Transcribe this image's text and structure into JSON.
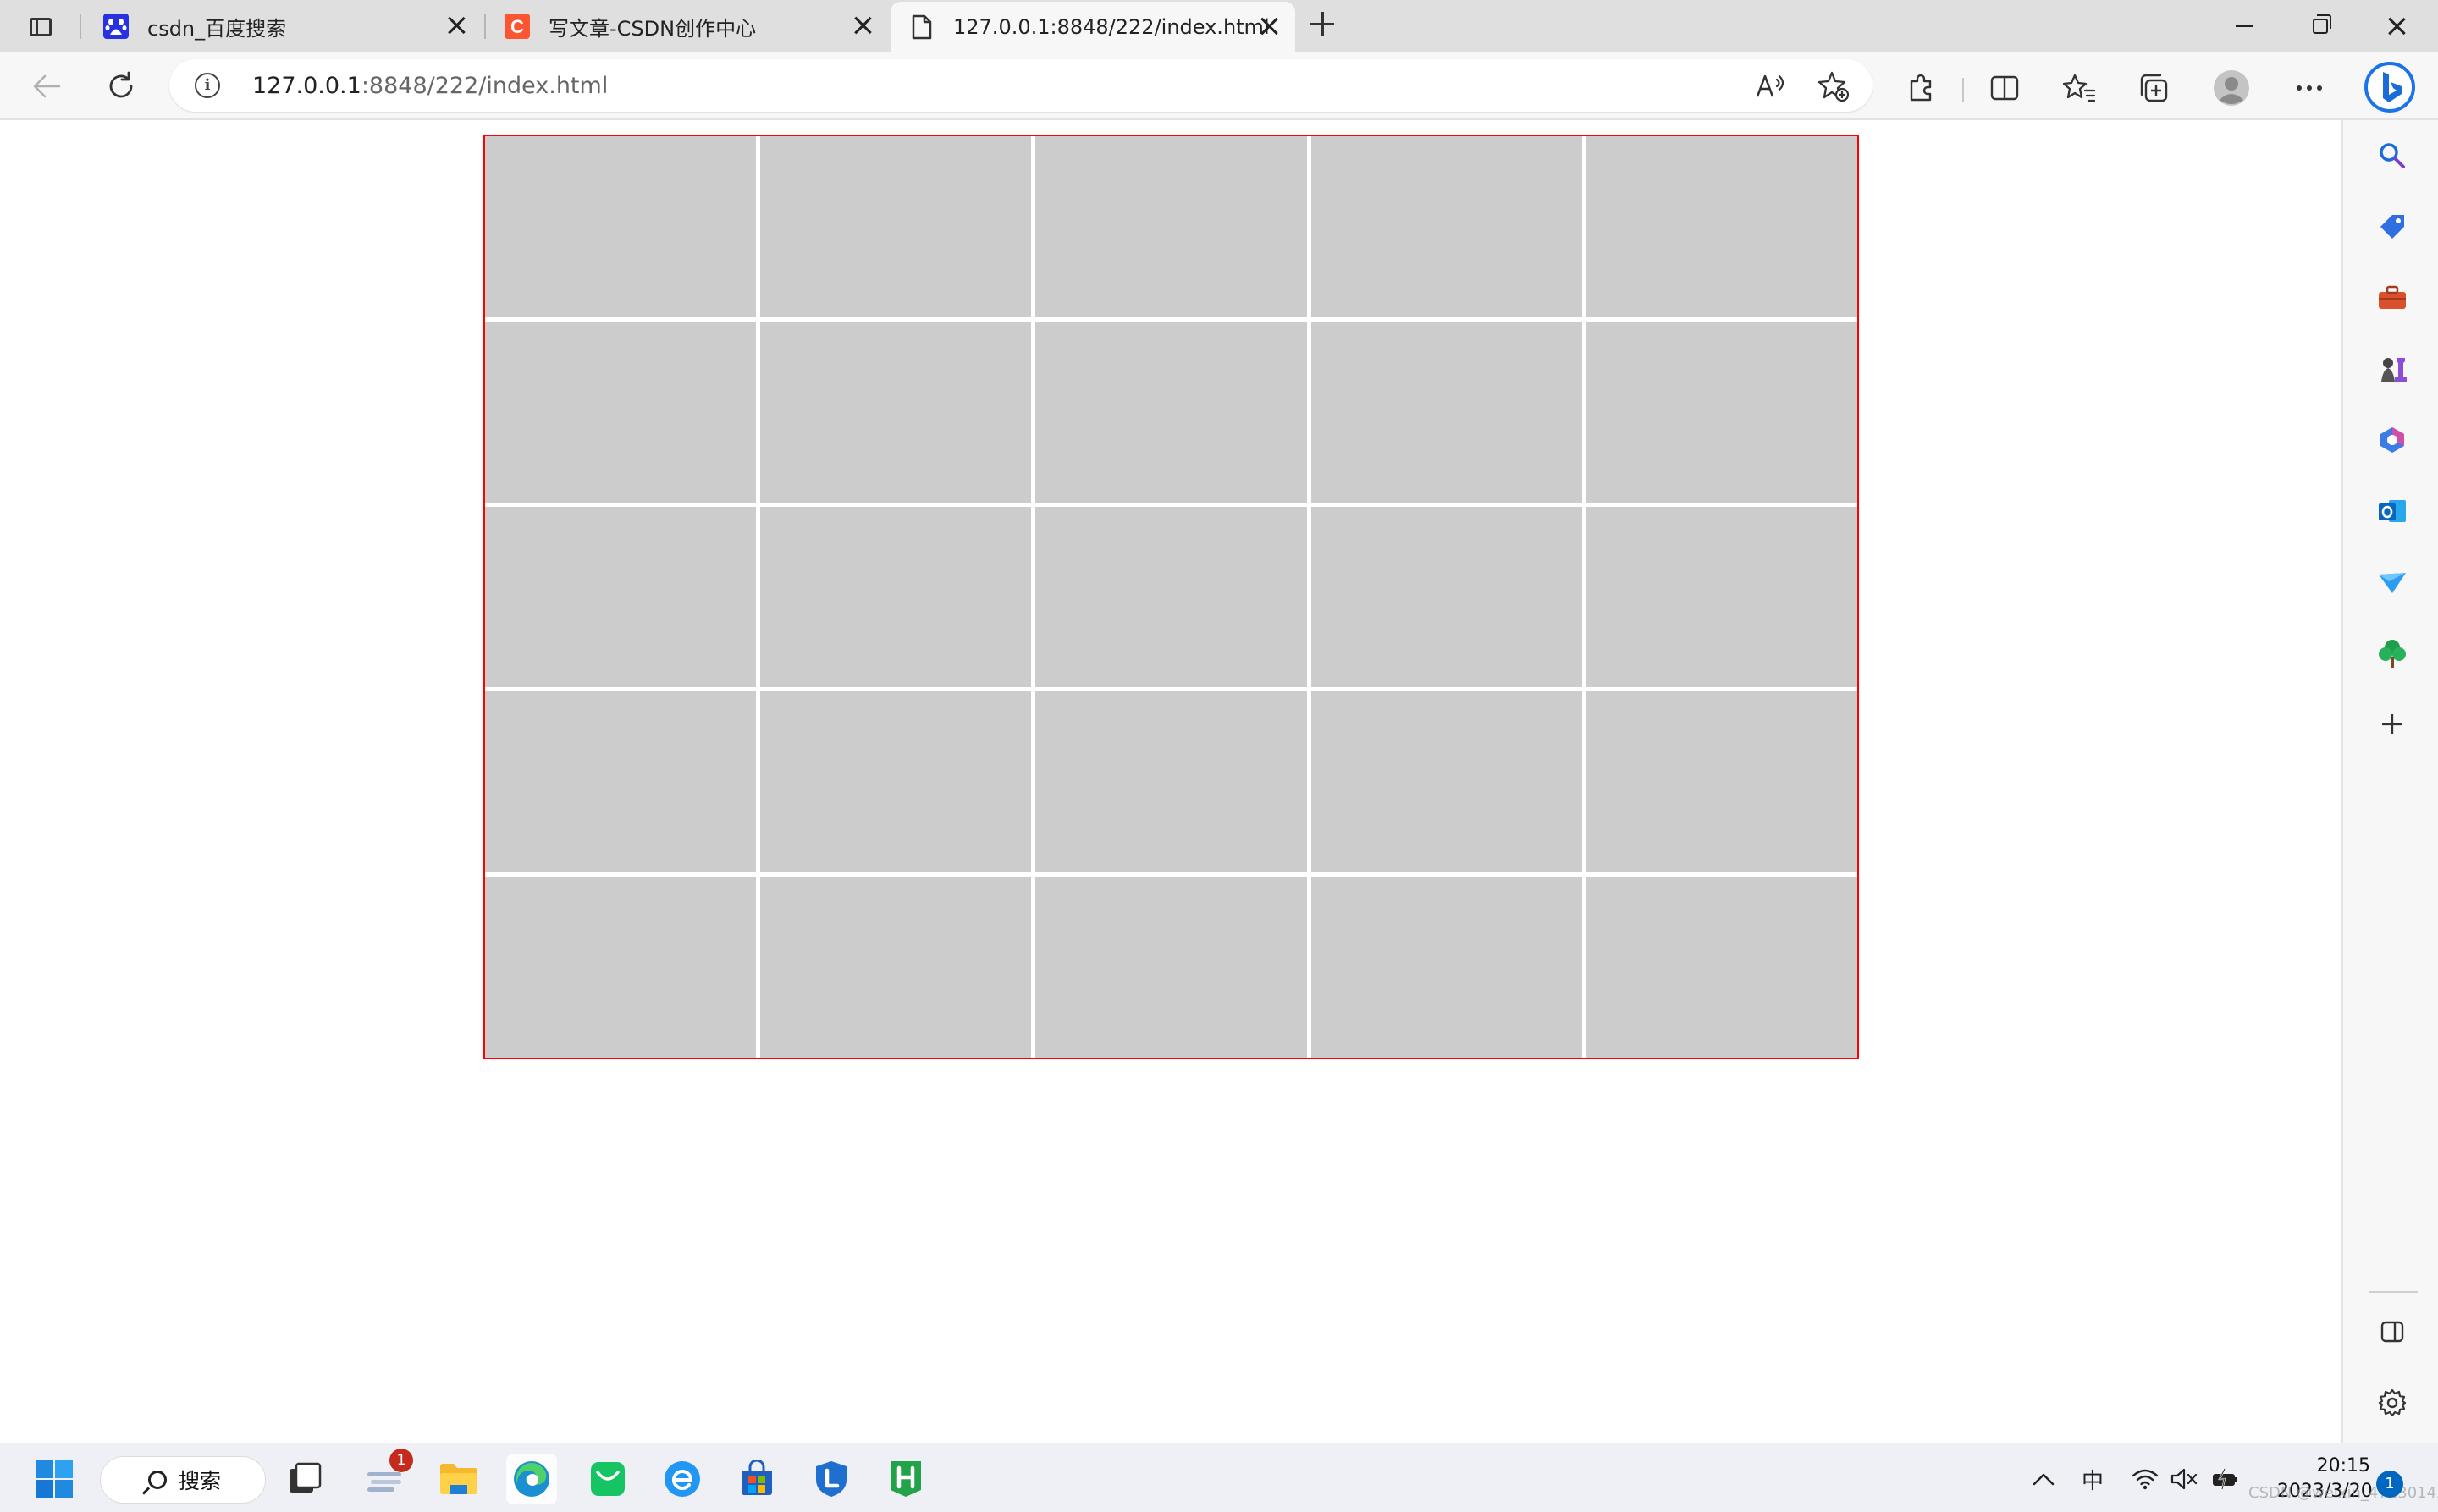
{
  "tabs": [
    {
      "label": "csdn_百度搜索",
      "favicon": "baidu-paw-icon"
    },
    {
      "label": "写文章-CSDN创作中心",
      "favicon": "csdn-logo-icon"
    },
    {
      "label": "127.0.0.1:8848/222/index.html",
      "favicon": "page-icon"
    }
  ],
  "address_bar": {
    "host": "127.0.0.1",
    "path": ":8848/222/index.html"
  },
  "page": {
    "grid_rows": 5,
    "grid_cols": 5,
    "cell_color": "#cccccc",
    "border_color": "#ff0000"
  },
  "taskbar": {
    "search_label": "搜索",
    "widgets_badge": "1",
    "ime_label": "中",
    "time": "20:15",
    "date": "2023/3/20",
    "notification_count": "1",
    "watermark": "CSDN @weixin_47130145"
  },
  "colors": {
    "accent": "#0067c0",
    "badge": "#c42b1c",
    "chrome": "#dfdfdf"
  }
}
